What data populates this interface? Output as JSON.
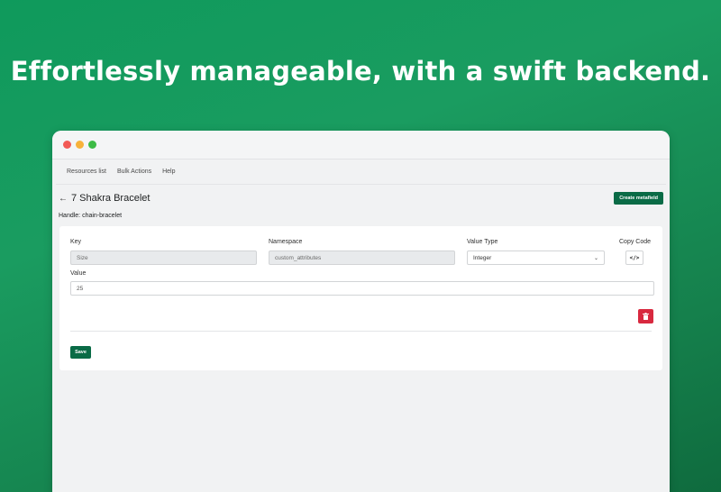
{
  "headline": "Effortlessly manageable, with a swift backend.",
  "colors": {
    "background": "#15944f",
    "primary_button": "#0a6b46",
    "delete_button": "#d8293f",
    "window_dot_red": "#f25a55",
    "window_dot_yellow": "#f7b23b",
    "window_dot_green": "#3dbb46"
  },
  "nav": {
    "items": [
      {
        "label": "Resources list"
      },
      {
        "label": "Bulk Actions"
      },
      {
        "label": "Help"
      }
    ]
  },
  "page": {
    "back_icon": "arrow-left-icon",
    "title": "7 Shakra Bracelet",
    "create_button": "Create metafield",
    "handle": "Handle: chain-bracelet"
  },
  "metafield": {
    "key_label": "Key",
    "key_value": "Size",
    "namespace_label": "Namespace",
    "namespace_value": "custom_attributes",
    "value_type_label": "Value Type",
    "value_type_selected": "Integer",
    "copy_code_label": "Copy Code",
    "copy_code_icon": "</>",
    "value_label": "Value",
    "value": "25",
    "delete_icon": "trash-icon"
  },
  "save_button": "Save"
}
